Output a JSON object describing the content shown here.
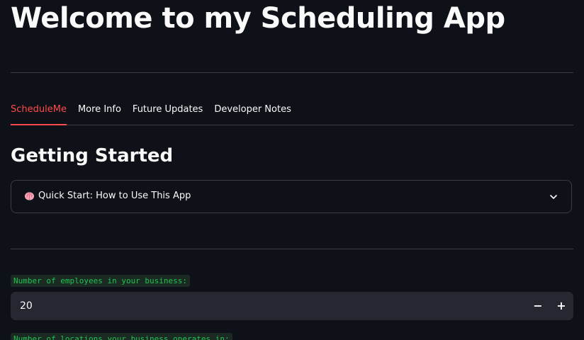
{
  "header": {
    "title": "Welcome to my Scheduling App"
  },
  "tabs": [
    {
      "label": "ScheduleMe",
      "active": true
    },
    {
      "label": "More Info",
      "active": false
    },
    {
      "label": "Future Updates",
      "active": false
    },
    {
      "label": "Developer Notes",
      "active": false
    }
  ],
  "main": {
    "section_heading": "Getting Started",
    "expander": {
      "icon": "brain-icon",
      "label": "Quick Start: How to Use This App",
      "chevron": "chevron-down-icon"
    },
    "employees": {
      "label": "Number of employees in your business:",
      "value": "20",
      "minus": "−",
      "plus": "+"
    },
    "locations": {
      "label": "Number of locations your business operates in:"
    }
  },
  "colors": {
    "background": "#0e1117",
    "accent": "#ff4b4b",
    "label_green": "#21c354",
    "input_bg": "#262730",
    "divider": "#3a3d46"
  }
}
